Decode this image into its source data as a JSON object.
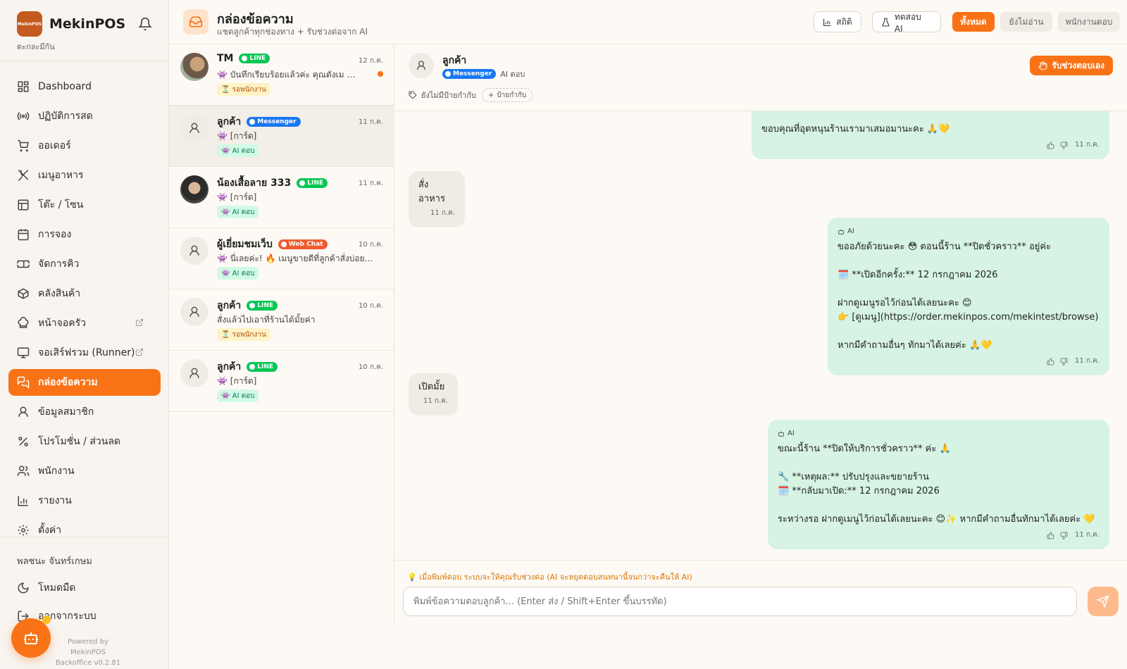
{
  "brand": {
    "name": "MekinPOS",
    "logo_text": "MekinPOS",
    "store": "ตะกละมีกัน"
  },
  "nav": [
    {
      "label": "Dashboard",
      "icon": "dashboard-icon"
    },
    {
      "label": "ปฏิบัติการสด",
      "icon": "broadcast-icon"
    },
    {
      "label": "ออเดอร์",
      "icon": "cart-icon"
    },
    {
      "label": "เมนูอาหาร",
      "icon": "utensils-icon"
    },
    {
      "label": "โต๊ะ / โซน",
      "icon": "table-icon"
    },
    {
      "label": "การจอง",
      "icon": "calendar-icon"
    },
    {
      "label": "จัดการคิว",
      "icon": "ticket-icon"
    },
    {
      "label": "คลังสินค้า",
      "icon": "box-icon"
    },
    {
      "label": "หน้าจอครัว",
      "icon": "chef-hat-icon"
    },
    {
      "label": "จอเสิร์ฟรวม (Runner)",
      "icon": "monitor-icon"
    },
    {
      "label": "กล่องข้อความ",
      "icon": "messages-icon"
    },
    {
      "label": "ข้อมูลสมาชิก",
      "icon": "user-icon"
    },
    {
      "label": "โปรโมชั่น / ส่วนลด",
      "icon": "percent-icon"
    },
    {
      "label": "พนักงาน",
      "icon": "users-icon"
    },
    {
      "label": "รายงาน",
      "icon": "bar-chart-icon"
    },
    {
      "label": "ตั้งค่า",
      "icon": "settings-icon"
    }
  ],
  "sidebar_footer": {
    "user": "พลชนะ จันทร์เกษม",
    "dark_mode": "โหมดมืด",
    "logout": "ออกจากระบบ",
    "powered": "Powered by MekinPOS",
    "version": "Backoffice v0.2.81"
  },
  "header": {
    "title": "กล่องข้อความ",
    "subtitle": "แชตลูกค้าทุกช่องทาง + รับช่วงต่อจาก AI",
    "stats_btn": "สถิติ",
    "test_ai_btn": "ทดสอบ AI",
    "filters": [
      "ทั้งหมด",
      "ยังไม่อ่าน",
      "พนักงานตอบ"
    ]
  },
  "conversations": [
    {
      "name": "TM",
      "channel": "LINE",
      "date": "12 ก.ค.",
      "preview": "👾 บันทึกเรียบร้อยแล้วค่ะ คุณตังเม ☀️ ทา...",
      "status": "⏳ รอพนักงาน",
      "status_type": "wait",
      "unread": true,
      "avatar": "photo1"
    },
    {
      "name": "ลูกค้า",
      "channel": "Messenger",
      "date": "11 ก.ค.",
      "preview": "👾 [การ์ด]",
      "status": "👾 AI ตอบ",
      "status_type": "ai",
      "unread": false,
      "avatar": "default"
    },
    {
      "name": "น้องเสื้อลาย 333",
      "channel": "LINE",
      "date": "11 ก.ค.",
      "preview": "👾 [การ์ด]",
      "status": "👾 AI ตอบ",
      "status_type": "ai",
      "unread": false,
      "avatar": "photo2"
    },
    {
      "name": "ผู้เยี่ยมชมเว็บ",
      "channel": "Web Chat",
      "date": "10 ก.ค.",
      "preview": "👾 นี่เลยค่ะ! 🔥 เมนูขายดีที่ลูกค้าสั่งบ่อยที่สุ...",
      "status": "👾 AI ตอบ",
      "status_type": "ai",
      "unread": false,
      "avatar": "default"
    },
    {
      "name": "ลูกค้า",
      "channel": "LINE",
      "date": "10 ก.ค.",
      "preview": "สั่งแล้วไปเอาที่ร้านได้มั้ยค่า",
      "status": "⏳ รอพนักงาน",
      "status_type": "wait",
      "unread": false,
      "avatar": "default"
    },
    {
      "name": "ลูกค้า",
      "channel": "LINE",
      "date": "10 ก.ค.",
      "preview": "👾 [การ์ด]",
      "status": "👾 AI ตอบ",
      "status_type": "ai",
      "unread": false,
      "avatar": "default"
    }
  ],
  "chat": {
    "name": "ลูกค้า",
    "channel": "Messenger",
    "responder": "AI ตอบ",
    "no_tags": "ยังไม่มีป้ายกำกับ",
    "add_tag": "ป้ายกำกับ",
    "takeover": "รับช่วงตอบเอง",
    "messages": [
      {
        "dir": "out",
        "ai_label": "",
        "text": "👉 [ดูเมนูทั้งหมด](https://order.mekinpos.com/mekintest/browse)\n\nขอบคุณที่อุดหนุนร้านเรามาเสมอมานะคะ 🙏💛",
        "time": "11 ก.ค."
      },
      {
        "dir": "in",
        "text": "สั่งอาหาร",
        "time": "11 ก.ค."
      },
      {
        "dir": "out",
        "ai_label": "AI",
        "text": "ขออภัยด้วยนะคะ 😳 ตอนนี้ร้าน **ปิดชั่วคราว** อยู่ค่ะ\n\n🗓️ **เปิดอีกครั้ง:** 12 กรกฎาคม 2026\n\nฝากดูเมนูรอไว้ก่อนได้เลยนะคะ 😊\n👉 [ดูเมนู](https://order.mekinpos.com/mekintest/browse)\n\nหากมีคำถามอื่นๆ ทักมาได้เลยค่ะ 🙏💛",
        "time": "11 ก.ค."
      },
      {
        "dir": "in",
        "text": "เปิดมั้ย",
        "time": "11 ก.ค."
      },
      {
        "dir": "out",
        "ai_label": "AI",
        "text": "ขณะนี้ร้าน **ปิดให้บริการชั่วคราว** ค่ะ 🙏\n\n🔧 **เหตุผล:** ปรับปรุงและขยายร้าน\n🗓️ **กลับมาเปิด:** 12 กรกฎาคม 2026\n\nระหว่างรอ ฝากดูเมนูไว้ก่อนได้เลยนะคะ 😊✨ หากมีคำถามอื่นทักมาได้เลยค่ะ 💛",
        "time": "11 ก.ค."
      }
    ]
  },
  "composer": {
    "hint": "💡 เมื่อพิมพ์ตอบ ระบบจะให้คุณรับช่วงต่อ (AI จะหยุดตอบสนทนานี้จนกว่าจะคืนให้ AI)",
    "placeholder": "พิมพ์ข้อความตอบลูกค้า... (Enter ส่ง / Shift+Enter ขึ้นบรรทัด)"
  },
  "colors": {
    "accent": "#f97316",
    "line": "#06c755",
    "messenger": "#1877f2",
    "webchat": "#ef5a2f",
    "ai_bubble": "#d6f3e4"
  }
}
